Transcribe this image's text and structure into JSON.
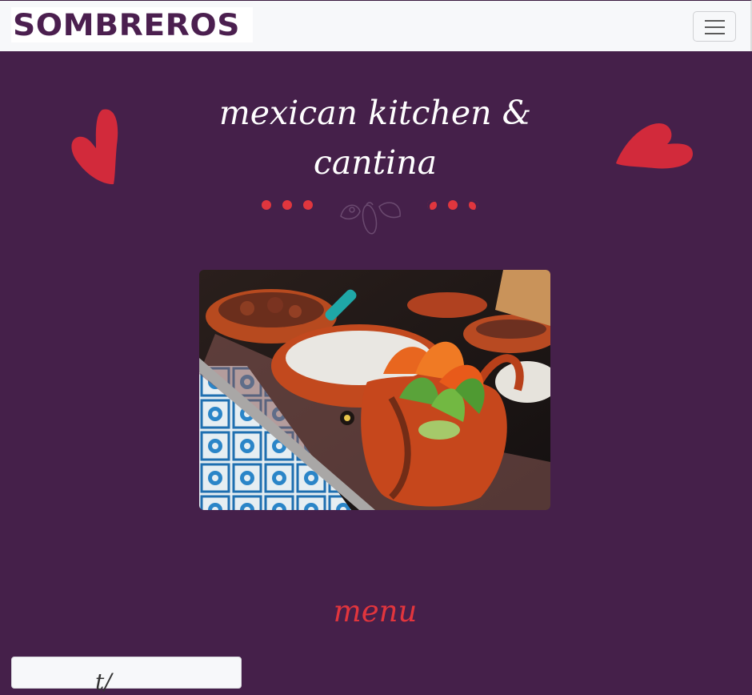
{
  "navbar": {
    "brand": "SOMBREROS",
    "toggler_icon": "hamburger-menu-icon"
  },
  "hero": {
    "title_line1": "mexican kitchen &",
    "title_line2": "cantina",
    "decoration_icon": "pepper-ornament-icon",
    "image_alt": "Mexican dishes in clay bowls on a tiled table"
  },
  "menu": {
    "heading": "menu",
    "card_partial_text": "t/"
  },
  "colors": {
    "background": "#45204a",
    "accent_red": "#e2353d",
    "navbar": "#f7f8fa",
    "brand": "#4b1f4f"
  }
}
